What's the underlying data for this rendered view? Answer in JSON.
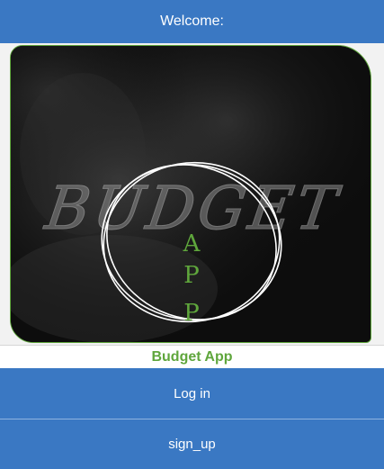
{
  "header": {
    "title": "Welcome:"
  },
  "hero": {
    "logo_word": "BUDGET",
    "logo_letters": [
      "A",
      "P",
      "P"
    ]
  },
  "caption": "Budget App",
  "actions": {
    "login_label": "Log in",
    "signup_label": "sign_up"
  },
  "colors": {
    "primary": "#3a78c3",
    "accent": "#5fa63c",
    "hero_background": "#0e0e0e"
  }
}
